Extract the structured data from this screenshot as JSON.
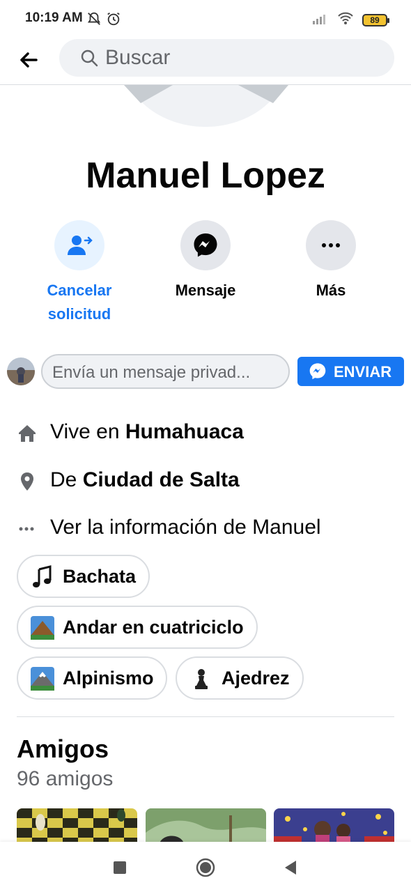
{
  "status_bar": {
    "time": "10:19 AM",
    "battery": "89",
    "icons": [
      "mute-icon",
      "alarm-icon",
      "signal-icon",
      "wifi-icon",
      "battery-icon"
    ]
  },
  "header": {
    "search_placeholder": "Buscar"
  },
  "profile": {
    "name": "Manuel Lopez"
  },
  "actions": {
    "cancel_line1": "Cancelar",
    "cancel_line2": "solicitud",
    "message": "Mensaje",
    "more": "Más"
  },
  "message_row": {
    "placeholder": "Envía un mensaje privad...",
    "send_label": "ENVIAR"
  },
  "info": {
    "lives_prefix": "Vive en ",
    "lives_place": "Humahuaca",
    "from_prefix": "De ",
    "from_place": "Ciudad de Salta",
    "see_more": "Ver la información de Manuel"
  },
  "hobbies": [
    {
      "label": "Bachata",
      "icon": "music-note-icon"
    },
    {
      "label": "Andar en cuatriciclo",
      "icon": "mountain-icon"
    },
    {
      "label": "Alpinismo",
      "icon": "snow-mountain-icon"
    },
    {
      "label": "Ajedrez",
      "icon": "chess-pawn-icon"
    }
  ],
  "friends": {
    "title": "Amigos",
    "count": "96 amigos"
  },
  "colors": {
    "accent": "#1877f2",
    "accent_light": "#e7f3ff",
    "button_grey": "#e4e6eb",
    "secondary_text": "#65676b",
    "battery": "#f2c230"
  }
}
